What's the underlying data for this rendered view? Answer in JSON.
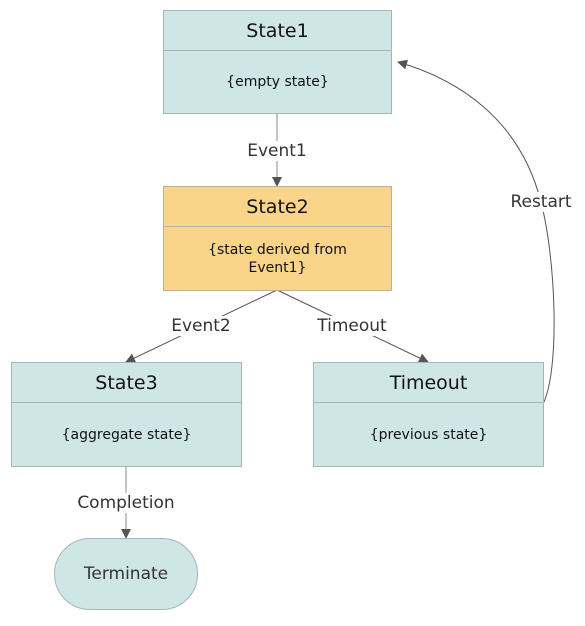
{
  "states": [
    {
      "title": "State1",
      "body": "{empty state}"
    },
    {
      "title": "State2",
      "body": "{state derived from Event1}"
    },
    {
      "title": "State3",
      "body": "{aggregate state}"
    },
    {
      "title": "Timeout",
      "body": "{previous state}"
    }
  ],
  "terminal": {
    "label": "Terminate"
  },
  "transitions": [
    {
      "label": "Event1",
      "from": "State1",
      "to": "State2"
    },
    {
      "label": "Event2",
      "from": "State2",
      "to": "State3"
    },
    {
      "label": "Timeout",
      "from": "State2",
      "to": "Timeout"
    },
    {
      "label": "Completion",
      "from": "State3",
      "to": "Terminate"
    },
    {
      "label": "Restart",
      "from": "Timeout",
      "to": "State1"
    }
  ],
  "colors": {
    "state": "#cfe6e7",
    "active_state": "#fad488",
    "edge": "#555555"
  }
}
